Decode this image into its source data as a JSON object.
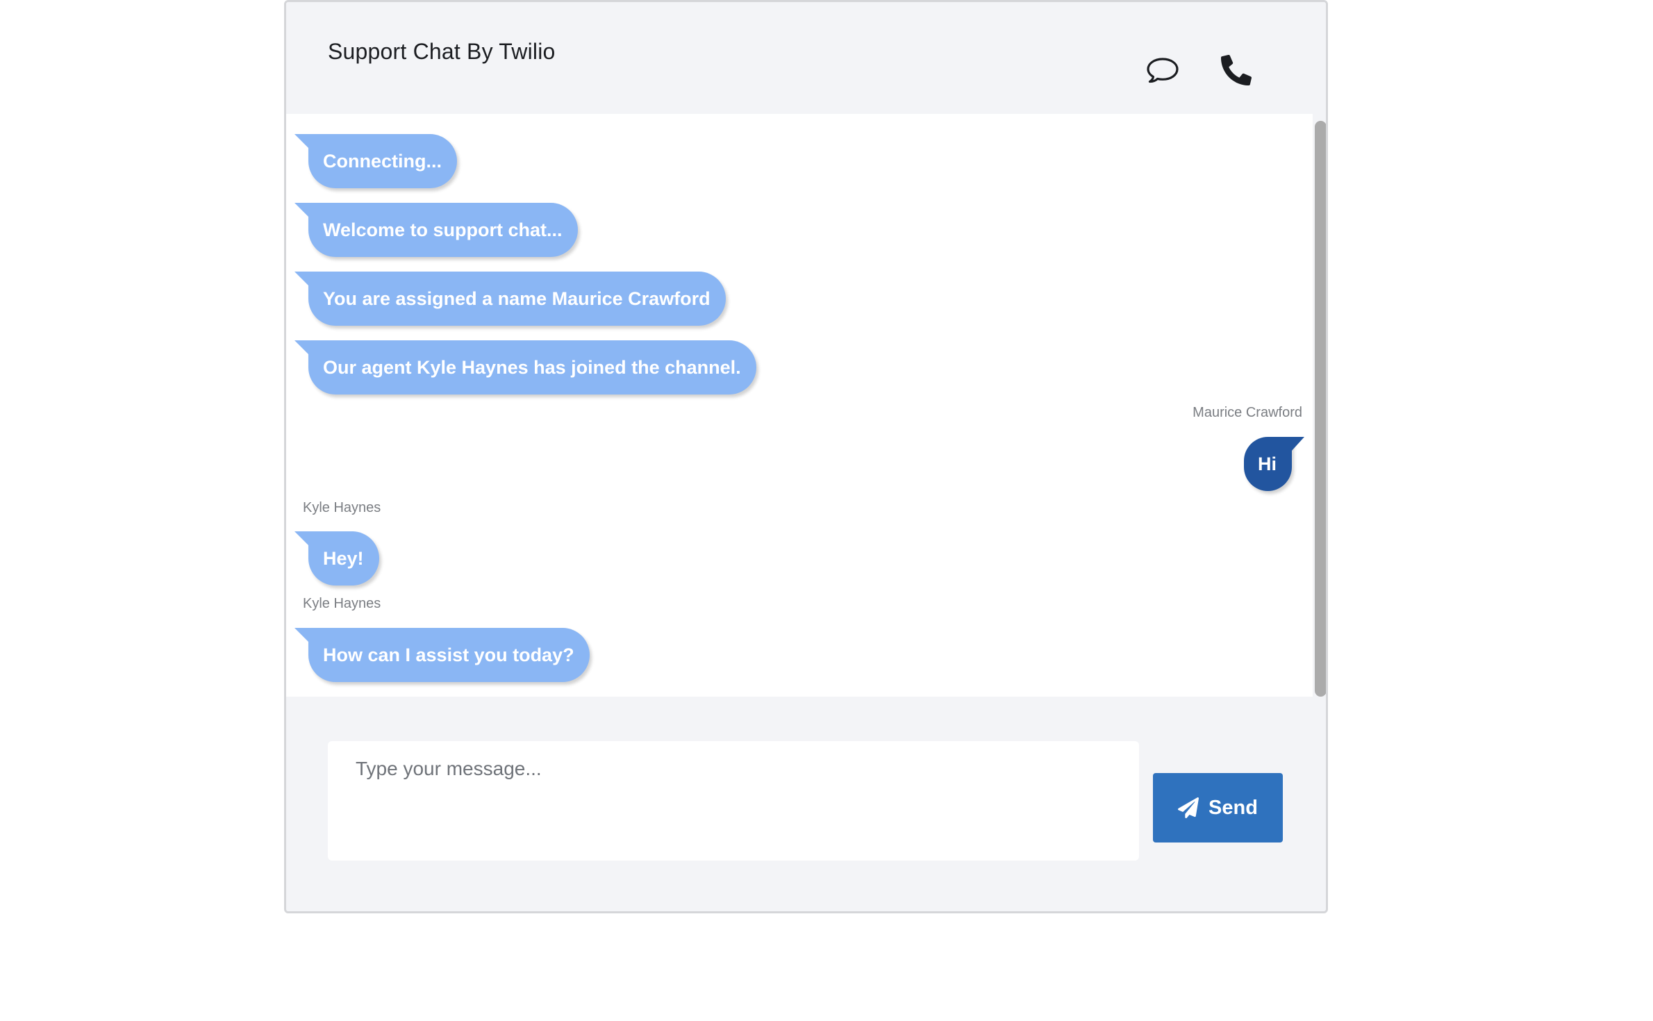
{
  "header": {
    "title": "Support Chat By Twilio",
    "icons": [
      "chat-bubble-icon",
      "phone-icon"
    ]
  },
  "messages": [
    {
      "from": "agent",
      "text": "Connecting..."
    },
    {
      "from": "agent",
      "text": "Welcome to support chat..."
    },
    {
      "from": "agent",
      "text": "You are assigned a name Maurice Crawford"
    },
    {
      "from": "agent",
      "text": "Our agent Kyle Haynes has joined the channel."
    },
    {
      "from": "user",
      "sender": "Maurice Crawford",
      "text": "Hi"
    },
    {
      "from": "agent",
      "sender": "Kyle Haynes",
      "text": "Hey!"
    },
    {
      "from": "agent",
      "sender": "Kyle Haynes",
      "text": "How can I assist you today?"
    }
  ],
  "composer": {
    "placeholder": "Type your message...",
    "send_label": "Send",
    "send_icon": "paper-plane-icon"
  },
  "colors": {
    "agent_bubble": "#8ab6f4",
    "user_bubble": "#22559f",
    "send_button": "#2f72be",
    "panel_background": "#f3f4f7"
  }
}
